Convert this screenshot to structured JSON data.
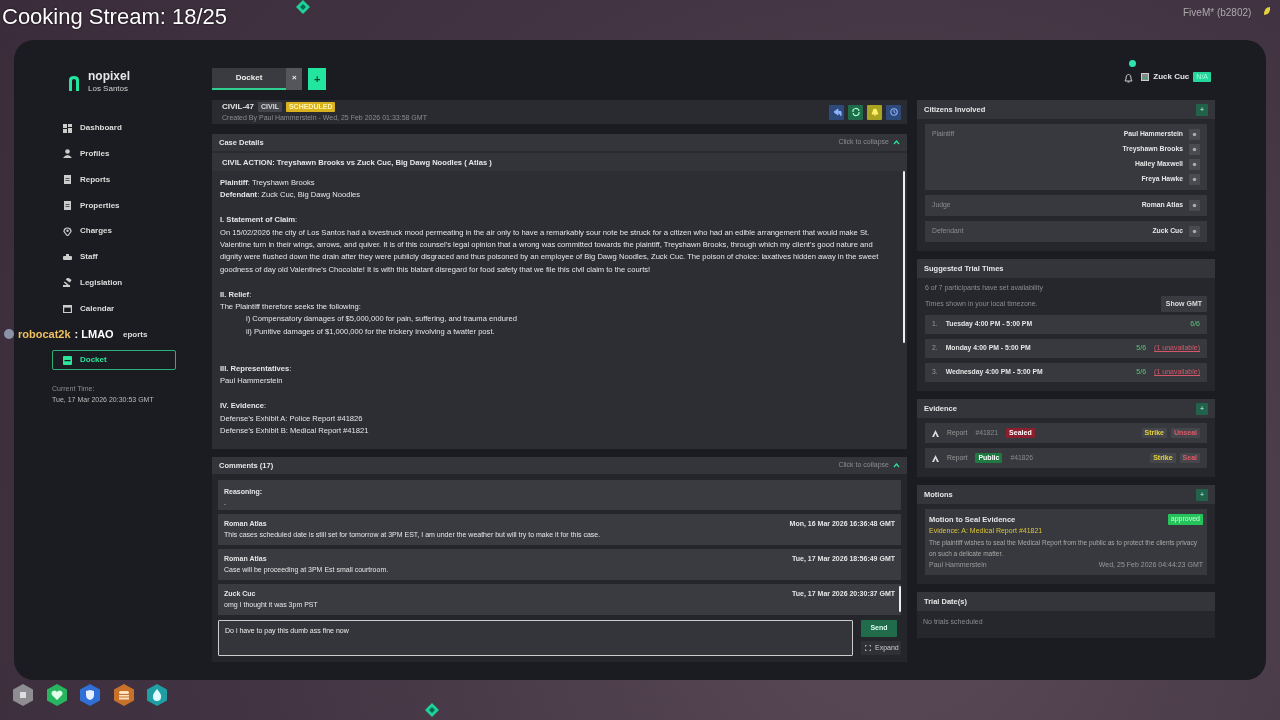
{
  "overlay": {
    "stream_title": "Cooking Stream: 18/25",
    "build": "FiveM* (b2802)",
    "chat": {
      "user": "robocat2k",
      "message": ": LMAO"
    }
  },
  "sidebar": {
    "brand": "nopixel",
    "city": "Los Santos",
    "items": [
      {
        "label": "Dashboard",
        "kind": "dashboard",
        "selected": false
      },
      {
        "label": "Profiles",
        "kind": "person",
        "selected": false
      },
      {
        "label": "Reports",
        "kind": "doc",
        "selected": false
      },
      {
        "label": "Properties",
        "kind": "doc",
        "selected": false
      },
      {
        "label": "Charges",
        "kind": "pin",
        "selected": false
      },
      {
        "label": "Staff",
        "kind": "staff",
        "selected": false
      },
      {
        "label": "Legislation",
        "kind": "gavel",
        "selected": false
      },
      {
        "label": "Calendar",
        "kind": "calendar",
        "selected": false
      },
      {
        "label": "eports",
        "kind": "covered",
        "selected": false
      },
      {
        "label": "Docket",
        "kind": "docket",
        "selected": true
      }
    ],
    "time_label": "Current Time:",
    "time": "Tue, 17 Mar 2026 20:30:53 GMT"
  },
  "tabs": [
    {
      "label": "Docket",
      "selected": true,
      "close": "×"
    }
  ],
  "add_tab": "+",
  "case": {
    "id": "CIVIL-47",
    "type": "CIVIL",
    "status": "SCHEDULED",
    "created": "Created By Paul Hammerstein - Wed, 25 Feb 2026 01:33:58 GMT",
    "actions": [
      {
        "kind": "reply"
      },
      {
        "kind": "refresh"
      },
      {
        "kind": "bell"
      },
      {
        "kind": "history"
      }
    ]
  },
  "details": {
    "title": "Case Details",
    "collapse": "Click to collapse",
    "heading": "CIVIL ACTION: Treyshawn Brooks vs Zuck Cuc, Big Dawg Noodles ( Atlas )",
    "blocks": [
      {
        "kind": "text",
        "text": "**Plaintiff**: Treyshawn Brooks"
      },
      {
        "kind": "text",
        "text": "**Defendant**: Zuck Cuc, Big Dawg Noodles"
      },
      {
        "kind": "gap"
      },
      {
        "kind": "text",
        "text": "**I. Statement of Claim**:"
      },
      {
        "kind": "text",
        "text": "On 15/02/2026 the city of Los Santos had a lovestruck mood permeating in the air only to have a remarkably sour note be struck for a citizen who had an edible arrangement that would make St. Valentine turn in their wings, arrows, and quiver. It is of this counsel's legal opinion that a wrong was committed towards the plaintiff, Treyshawn Brooks, through which my client's good nature and dignity were flushed down the drain after they were publicly disgraced and thus poisoned by an employee of Big Dawg Noodles, Zuck Cuc. The poison of choice: laxatives hidden away in the sweet goodness of day old Valentine's Chocolate! It is with this blatant disregard for food safety that we file this civil claim to the courts!"
      },
      {
        "kind": "gap"
      },
      {
        "kind": "text",
        "text": "**II. Relief**:"
      },
      {
        "kind": "text",
        "text": "The Plaintiff therefore seeks the following:"
      },
      {
        "kind": "indent",
        "text": "i) Compensatory damages of $5,000,000 for pain, suffering, and trauma endured"
      },
      {
        "kind": "indent",
        "text": "ii) Punitive damages of $1,000,000 for the trickery involving a twatter post."
      },
      {
        "kind": "gap"
      },
      {
        "kind": "gap"
      },
      {
        "kind": "text",
        "text": "**III. Representatives**:"
      },
      {
        "kind": "text",
        "text": "Paul Hammerstein"
      },
      {
        "kind": "gap"
      },
      {
        "kind": "text",
        "text": "**IV. Evidence**:"
      },
      {
        "kind": "text",
        "text": "Defense’s Exhibit A: Police Report #41826"
      },
      {
        "kind": "text",
        "text": "Defense’s Exhibit B: Medical Report #41821"
      }
    ]
  },
  "comments": {
    "title": "Comments (17)",
    "collapse": "Click to collapse",
    "items": [
      {
        "kind": "partial",
        "label": "Reasoning:",
        "text": "."
      },
      {
        "kind": "comment",
        "author": "Roman Atlas",
        "time": "Mon, 16 Mar 2026 16:36:48 GMT",
        "text": "This cases scheduled date is still set for tomorrow at 3PM EST, I am under the weather but will try to make it for this case."
      },
      {
        "kind": "comment",
        "author": "Roman Atlas",
        "time": "Tue, 17 Mar 2026 18:56:49 GMT",
        "text": "Case will be proceeding at 3PM Est small courtroom."
      },
      {
        "kind": "comment",
        "author": "Zuck Cuc",
        "time": "Tue, 17 Mar 2026 20:30:37 GMT",
        "text": "omg I thought it was 3pm PST"
      }
    ],
    "input": "Do i have to pay this dumb ass fine now",
    "send": "Send",
    "expand": "Expand"
  },
  "user": {
    "name": "Zuck Cuc",
    "status": "N/A"
  },
  "citizens": {
    "title": "Citizens Involved",
    "add": "+",
    "groups": [
      {
        "role": "Plaintiff",
        "names": [
          "Paul Hammerstein",
          "Treyshawn Brooks",
          "Hailey Maxwell",
          "Freya Hawke"
        ]
      },
      {
        "role": "Judge",
        "names": [
          "Roman Atlas"
        ]
      },
      {
        "role": "Defendant",
        "names": [
          "Zuck Cuc"
        ]
      }
    ]
  },
  "trial_times": {
    "title": "Suggested Trial Times",
    "note": "6 of 7 participants have set availability",
    "timezone": "Times shown in your local timezone.",
    "toggle": "Show GMT",
    "slots": [
      {
        "number": "1.",
        "label": "Tuesday 4:00 PM - 5:00 PM",
        "count": "6/6"
      },
      {
        "number": "2.",
        "label": "Monday 4:00 PM - 5:00 PM",
        "count": "5/6",
        "unavailable": "(1 unavailable)"
      },
      {
        "number": "3.",
        "label": "Wednesday 4:00 PM - 5:00 PM",
        "count": "5/6",
        "unavailable": "(1 unavailable)"
      }
    ]
  },
  "evidence": {
    "title": "Evidence",
    "add": "+",
    "items": [
      {
        "type": "Report",
        "number": "#41821",
        "tag": "Sealed",
        "color": "#8a1f2e",
        "tag_first": false,
        "actions": [
          {
            "label": "Strike",
            "kind": "strike"
          },
          {
            "label": "Unseal",
            "kind": "seal"
          }
        ]
      },
      {
        "type": "Report",
        "number": "#41826",
        "tag": "Public",
        "color": "#1f7a41",
        "tag_first": true,
        "actions": [
          {
            "label": "Strike",
            "kind": "strike"
          },
          {
            "label": "Seal",
            "kind": "seal"
          }
        ]
      }
    ]
  },
  "motions": {
    "title": "Motions",
    "add": "+",
    "items": [
      {
        "title": "Motion to Seal Evidence",
        "status": "approved",
        "evidence": "Evidence: A: Medical Report #41821",
        "text": "The plaintiff wishes to seal the Medical Report from the public as to protect the clients privacy on such a delicate matter.",
        "author": "Paul Hammerstein",
        "time": "Wed, 25 Feb 2026 04:44:23 GMT"
      }
    ]
  },
  "trial_dates": {
    "title": "Trial Date(s)",
    "empty": "No trials scheduled"
  }
}
